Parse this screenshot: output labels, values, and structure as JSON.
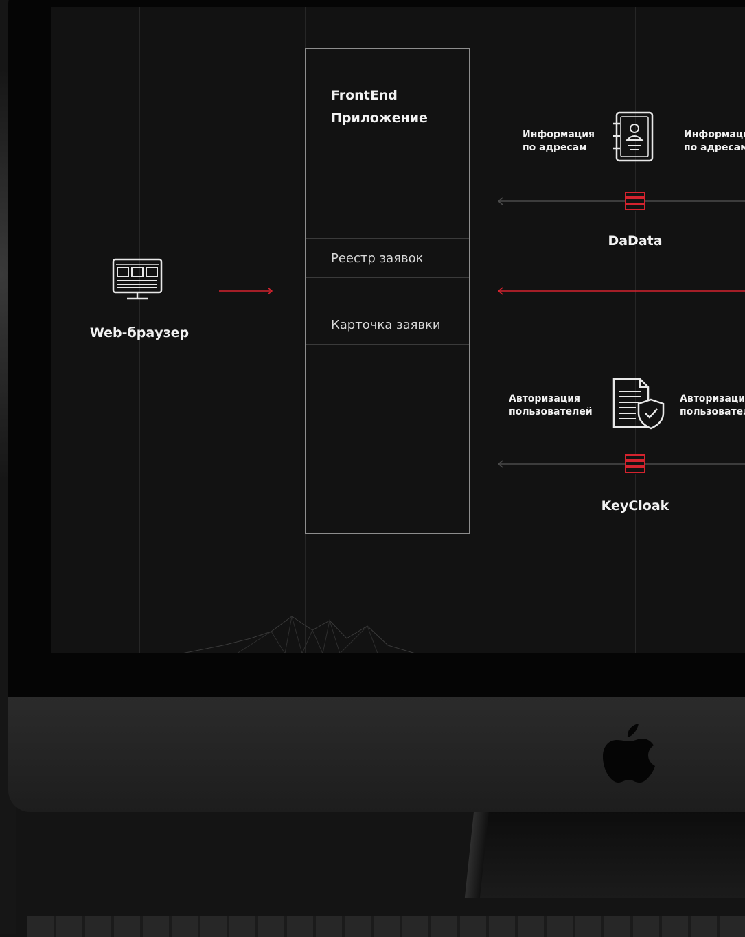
{
  "diagram": {
    "client": {
      "label": "Web-браузер",
      "icon": "monitor-icon"
    },
    "frontend": {
      "title_line1": "FrontEnd",
      "title_line2": "Приложение",
      "modules": [
        "Реестр заявок",
        "Карточка заявки"
      ]
    },
    "services": [
      {
        "name": "DaData",
        "icon": "address-book-icon",
        "left_note": [
          "Информация",
          "по адресам"
        ],
        "right_note": [
          "Информаци",
          "по адресам"
        ]
      },
      {
        "name": "KeyCloak",
        "icon": "document-shield-icon",
        "left_note": [
          "Авторизация",
          "пользователей"
        ],
        "right_note": [
          "Авторизация",
          "пользовател"
        ]
      }
    ]
  },
  "colors": {
    "accent": "#d3232e",
    "connector": "#4a4a4a",
    "text": "#f2f2f2",
    "box_border": "#8d8d8d"
  },
  "device": {
    "logo": "apple-logo-icon"
  }
}
